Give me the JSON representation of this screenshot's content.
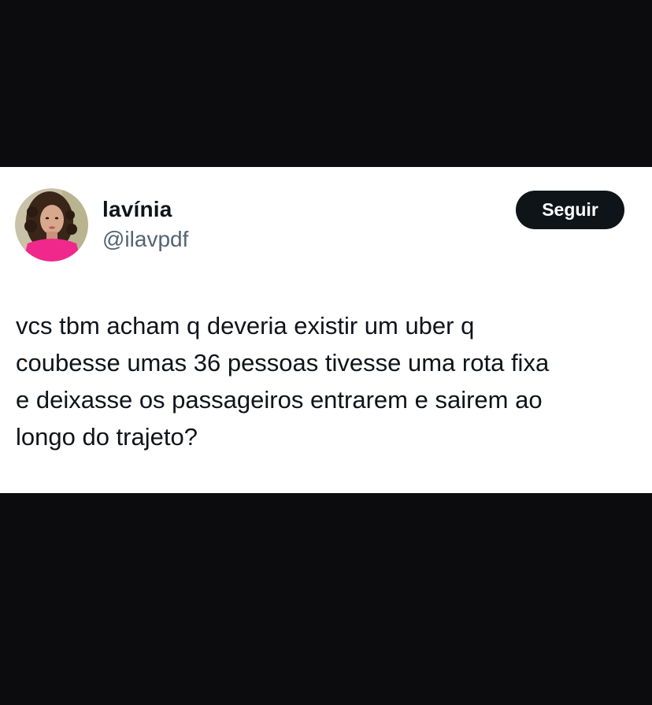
{
  "tweet": {
    "author": {
      "display_name": "lavínia",
      "handle": "@ilavpdf",
      "avatar_icon": "profile-photo"
    },
    "follow_button_label": "Seguir",
    "text_lines": [
      "vcs tbm acham q deveria existir um uber q",
      "coubesse umas 36 pessoas tivesse uma rota fixa",
      "e deixasse os passageiros entrarem e sairem ao",
      "longo do trajeto?"
    ]
  },
  "colors": {
    "background": "#0c0c0e",
    "card": "#ffffff",
    "text_primary": "#0f1419",
    "text_secondary": "#536471",
    "button_bg": "#0f1419",
    "avatar_shirt": "#f0288c"
  }
}
